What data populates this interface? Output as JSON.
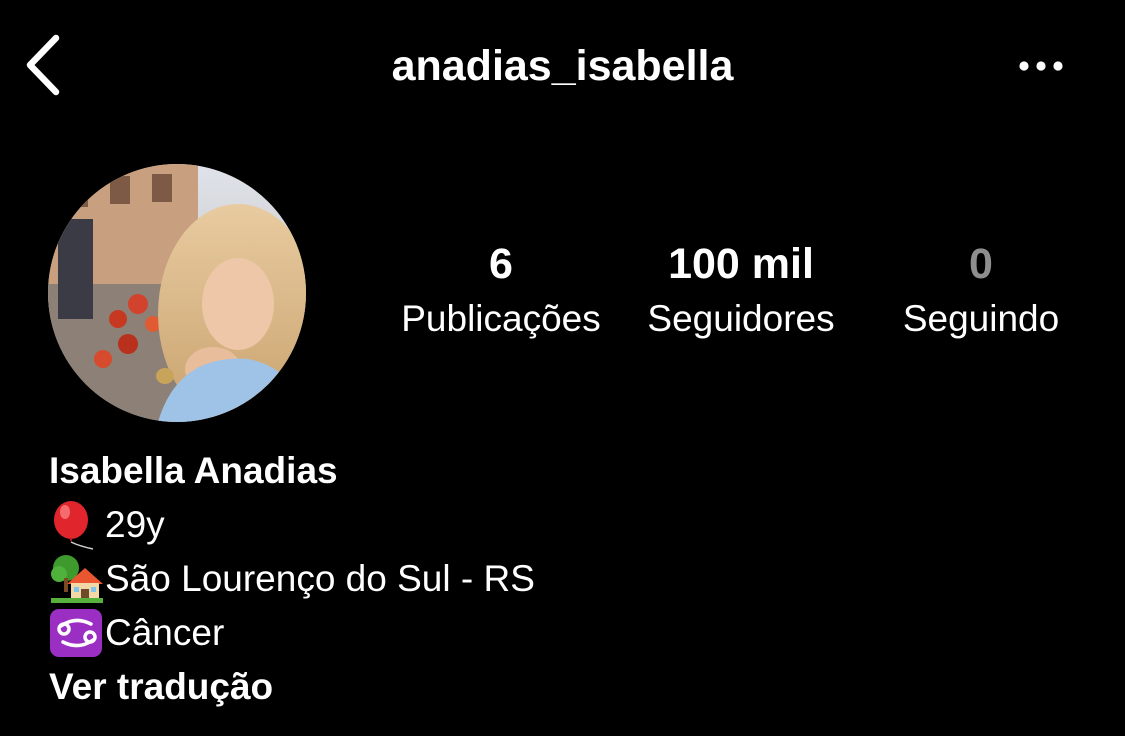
{
  "header": {
    "username": "anadias_isabella"
  },
  "stats": {
    "posts": {
      "value": "6",
      "label": "Publicações"
    },
    "followers": {
      "value": "100 mil",
      "label": "Seguidores"
    },
    "following": {
      "value": "0",
      "label": "Seguindo"
    }
  },
  "bio": {
    "display_name": "Isabella Anadias",
    "lines": [
      {
        "icon": "balloon-icon",
        "text": " 29y"
      },
      {
        "icon": "house-with-garden-icon",
        "text": "São Lourenço do Sul - RS"
      },
      {
        "icon": "cancer-zodiac-icon",
        "text": " Câncer"
      }
    ],
    "translate_label": "Ver tradução"
  },
  "colors": {
    "background": "#000000",
    "text": "#ffffff",
    "muted": "#8e8e8e",
    "zodiac_badge": "#9b2fc4"
  }
}
